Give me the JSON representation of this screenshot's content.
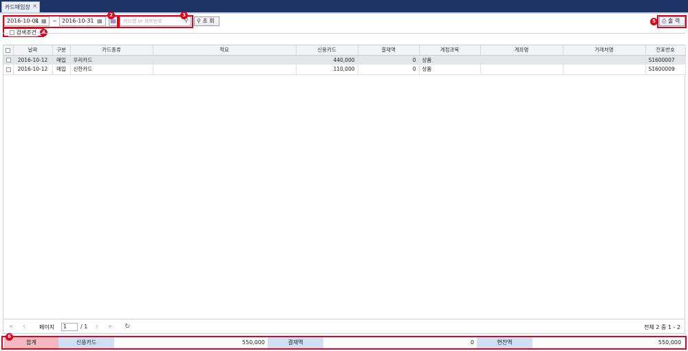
{
  "tab": {
    "title": "카드매입장",
    "close": "×"
  },
  "toolbar": {
    "date_from": "2016-10-01",
    "date_from_clear": "×",
    "date_sep": "~",
    "date_to": "2016-10-31",
    "search_placeholder": "카드명 or 카드번호",
    "search_label": "조 회",
    "print_label": "출 력"
  },
  "badges": [
    "2",
    "3",
    "4",
    "5",
    "6"
  ],
  "filter": {
    "label": "검색조건"
  },
  "grid": {
    "columns": [
      "날짜",
      "구분",
      "카드종류",
      "적요",
      "신용카드",
      "결재액",
      "계정과목",
      "계좌명",
      "거래처명",
      "전표번호"
    ],
    "rows": [
      {
        "date": "2016-10-12",
        "type": "매입",
        "card": "우리카드",
        "memo": "",
        "credit": "440,000",
        "paid": "0",
        "account": "상품",
        "acct_name": "",
        "client": "",
        "voucher": "S1600007"
      },
      {
        "date": "2016-10-12",
        "type": "매입",
        "card": "신한카드",
        "memo": "",
        "credit": "110,000",
        "paid": "0",
        "account": "상품",
        "acct_name": "",
        "client": "",
        "voucher": "S1600009"
      }
    ]
  },
  "pager": {
    "page_label": "페이지",
    "page": "1",
    "total_pages": "/ 1",
    "summary": "전체 2 중 1 - 2"
  },
  "summary": {
    "total_label": "합계",
    "credit_label": "신용카드",
    "credit_value": "550,000",
    "paid_label": "결재액",
    "paid_value": "0",
    "cash_label": "현찬액",
    "cash_value": "550,000"
  },
  "colors": {
    "tabbar": "#1f3466",
    "highlight": "#e3001b",
    "total_bg": "#f4b8c2",
    "label_bg": "#cfe0f5"
  }
}
